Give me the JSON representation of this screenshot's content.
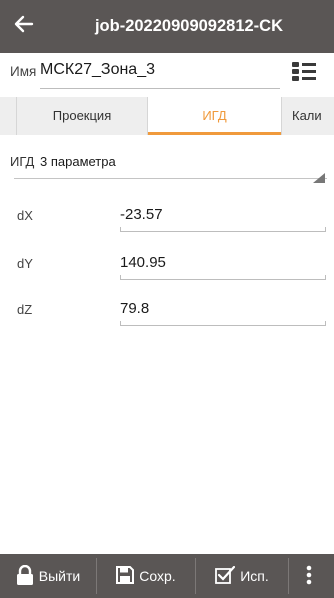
{
  "header": {
    "back_icon": "arrow-left-icon",
    "title": "job-20220909092812-CK"
  },
  "name_row": {
    "label": "Имя",
    "value": "МСК27_Зона_3",
    "list_icon": "list-icon"
  },
  "tabs": [
    {
      "label": "Проекция",
      "active": false
    },
    {
      "label": "ИГД",
      "active": true
    },
    {
      "label": "Кали",
      "active": false
    }
  ],
  "igd": {
    "label": "ИГД",
    "value": "3 параметра"
  },
  "fields": [
    {
      "label": "dX",
      "value": "-23.57"
    },
    {
      "label": "dY",
      "value": "140.95"
    },
    {
      "label": "dZ",
      "value": "79.8"
    }
  ],
  "bottom_bar": {
    "exit_label": "Выйти",
    "exit_icon": "lock-icon",
    "save_label": "Сохр.",
    "save_icon": "save-icon",
    "use_label": "Исп.",
    "use_icon": "check-box-icon",
    "more_icon": "more-vertical-icon"
  },
  "colors": {
    "bar_bg": "#5a5655",
    "accent": "#f09a3c",
    "tab_bg": "#eeeeee"
  }
}
